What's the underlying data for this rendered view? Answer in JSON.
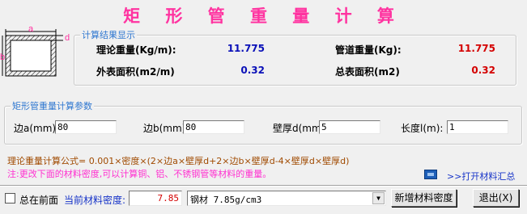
{
  "title": "矩 形 管 重 量 计 算",
  "diagram": {
    "label_a": "a",
    "label_b": "b",
    "label_d": "d"
  },
  "results": {
    "legend": "计算结果显示",
    "theory_weight_label": "理论重量(Kg/m):",
    "theory_weight_value": "11.775",
    "pipe_weight_label": "管道重量(Kg):",
    "pipe_weight_value": "11.775",
    "outer_area_label": "外表面积(m2/m)",
    "outer_area_value": "0.32",
    "total_area_label": "总表面积(m2)",
    "total_area_value": "0.32"
  },
  "params": {
    "legend": "矩形管重量计算参数",
    "side_a_label": "边a(mm):",
    "side_a_value": "80",
    "side_b_label": "边b(mm):",
    "side_b_value": "80",
    "thickness_label": "壁厚d(mm):",
    "thickness_value": "5",
    "length_label": "长度l(m):",
    "length_value": "1"
  },
  "formula": "理论重量计算公式= 0.001×密度×(2×边a×壁厚d+2×边b×壁厚d-4×壁厚d×壁厚d)",
  "note": "注:更改下面的材料密度,可以计算铜、铝、不锈钢管等材料的重量。",
  "open_library_label": ">>打开材料汇总",
  "bottom": {
    "front_label": "总在前面",
    "density_label": "当前材料密度:",
    "density_value": "7.85",
    "material_selected": "钢材 7.85g/cm3",
    "new_material_label": "新增材料密度",
    "exit_label": "退出(X)"
  },
  "colors": {
    "title": "#ff33a0",
    "legend": "#2f77d0",
    "value_blue": "#0a10b8",
    "value_red": "#d40000",
    "formula": "#a04a00",
    "note": "#ff2fd0",
    "link": "#1633c8"
  },
  "icons": {
    "library": "library-icon",
    "checkbox": "checkbox-icon",
    "dropdown": "chevron-down-icon"
  }
}
